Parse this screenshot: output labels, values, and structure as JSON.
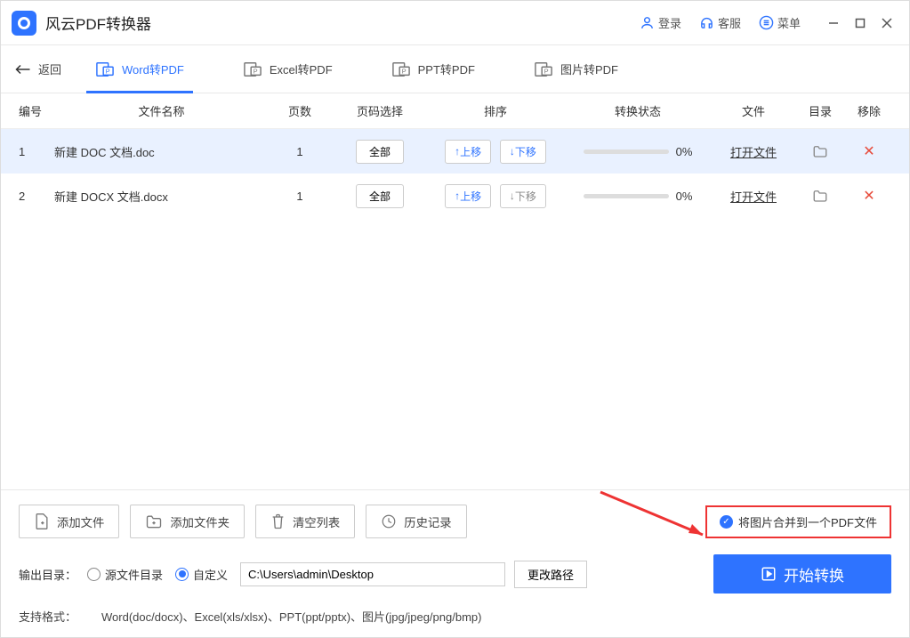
{
  "titlebar": {
    "app_title": "风云PDF转换器",
    "login": "登录",
    "support": "客服",
    "menu": "菜单"
  },
  "tabs": {
    "back": "返回",
    "word": "Word转PDF",
    "excel": "Excel转PDF",
    "ppt": "PPT转PDF",
    "image": "图片转PDF"
  },
  "headers": {
    "num": "编号",
    "name": "文件名称",
    "pages": "页数",
    "pagesel": "页码选择",
    "sort": "排序",
    "status": "转换状态",
    "file": "文件",
    "dir": "目录",
    "remove": "移除"
  },
  "buttons": {
    "all": "全部",
    "move_up": "上移",
    "move_down": "下移",
    "open_file": "打开文件"
  },
  "rows": [
    {
      "num": "1",
      "name": "新建 DOC 文档.doc",
      "pages": "1",
      "percent": "0%"
    },
    {
      "num": "2",
      "name": "新建 DOCX 文档.docx",
      "pages": "1",
      "percent": "0%"
    }
  ],
  "footer": {
    "add_file": "添加文件",
    "add_folder": "添加文件夹",
    "clear_list": "清空列表",
    "history": "历史记录",
    "merge_label": "将图片合并到一个PDF文件",
    "output_label": "输出目录：",
    "radio_source": "源文件目录",
    "radio_custom": "自定义",
    "path_value": "C:\\Users\\admin\\Desktop",
    "change_path": "更改路径",
    "start": "开始转换",
    "format_label": "支持格式：",
    "format_value": "Word(doc/docx)、Excel(xls/xlsx)、PPT(ppt/pptx)、图片(jpg/jpeg/png/bmp)"
  }
}
